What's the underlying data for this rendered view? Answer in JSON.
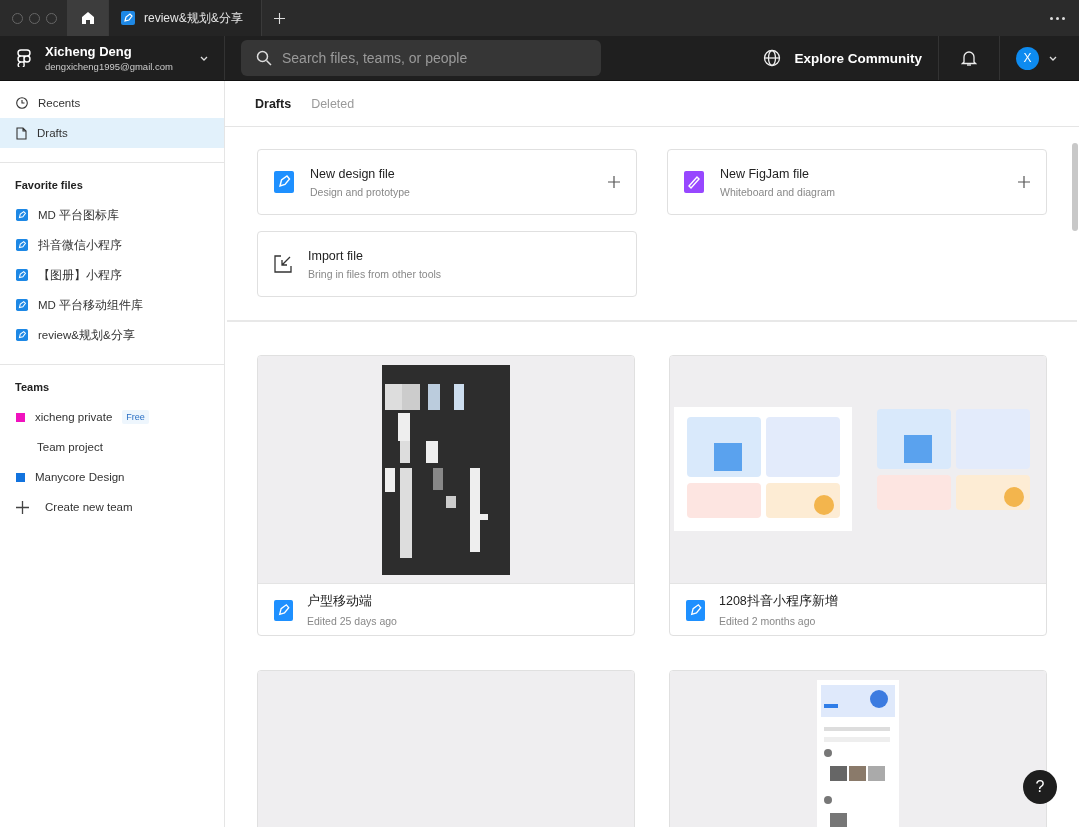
{
  "titlebar": {
    "tabs": [
      {
        "kind": "home",
        "selected": true
      },
      {
        "kind": "file",
        "label": "review&规划&分享",
        "selected": false
      }
    ]
  },
  "header": {
    "account": {
      "name": "Xicheng Deng",
      "email": "dengxicheng1995@gmail.com"
    },
    "search": {
      "placeholder": "Search files, teams, or people"
    },
    "explore": "Explore Community",
    "avatar": "X"
  },
  "sidebar": {
    "nav": [
      {
        "kind": "recents",
        "label": "Recents",
        "selected": false
      },
      {
        "kind": "drafts",
        "label": "Drafts",
        "selected": true
      }
    ],
    "favorites": {
      "heading": "Favorite files",
      "items": [
        "MD 平台图标库",
        "抖音微信小程序",
        "【图册】小程序",
        "MD 平台移动组件库",
        "review&规划&分享"
      ]
    },
    "teams": {
      "heading": "Teams",
      "items": [
        {
          "name": "xicheng private",
          "color": "#f012be",
          "badge": "Free",
          "children": [
            {
              "name": "Team project"
            }
          ]
        },
        {
          "name": "Manycore Design",
          "color": "#1273de"
        }
      ],
      "create": "Create new team"
    }
  },
  "main": {
    "tabs": [
      {
        "label": "Drafts",
        "selected": true
      },
      {
        "label": "Deleted",
        "selected": false
      }
    ],
    "create": [
      {
        "kind": "design",
        "title": "New design file",
        "subtitle": "Design and prototype"
      },
      {
        "kind": "figjam",
        "title": "New FigJam file",
        "subtitle": "Whiteboard and diagram"
      },
      {
        "kind": "import",
        "title": "Import file",
        "subtitle": "Bring in files from other tools"
      }
    ],
    "files": [
      {
        "kind": "picture",
        "name": "户型移动端",
        "edited": "Edited 25 days ago"
      },
      {
        "kind": "picture",
        "name": "1208抖音小程序新增",
        "edited": "Edited 2 months ago"
      },
      {
        "kind": "blank"
      },
      {
        "kind": "picture"
      }
    ]
  },
  "help": "?"
}
